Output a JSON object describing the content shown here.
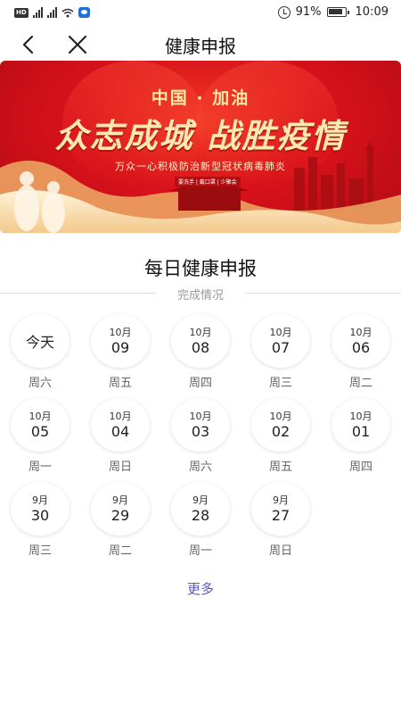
{
  "status_bar": {
    "network_tag": "HD",
    "sig1_tag": "4G",
    "sig2_tag": "4G",
    "battery": "91%",
    "time": "10:09"
  },
  "nav": {
    "title": "健康申报",
    "back_icon": "back-chevron-icon",
    "close_icon": "close-icon"
  },
  "banner": {
    "subtitle": "中国 · 加油",
    "headline": "众志成城 战胜疫情",
    "description": "万众一心积极防治新型冠状病毒肺炎",
    "footer_tag": "要洗手 | 戴口罩 | 少聚会",
    "colors": {
      "background": "#d8121b",
      "text": "#ffe9b0"
    }
  },
  "section": {
    "title": "每日健康申报",
    "divider_label": "完成情况"
  },
  "days": [
    {
      "today": "今天",
      "month": "",
      "day": "",
      "weekday": "周六"
    },
    {
      "today": "",
      "month": "10月",
      "day": "09",
      "weekday": "周五"
    },
    {
      "today": "",
      "month": "10月",
      "day": "08",
      "weekday": "周四"
    },
    {
      "today": "",
      "month": "10月",
      "day": "07",
      "weekday": "周三"
    },
    {
      "today": "",
      "month": "10月",
      "day": "06",
      "weekday": "周二"
    },
    {
      "today": "",
      "month": "10月",
      "day": "05",
      "weekday": "周一"
    },
    {
      "today": "",
      "month": "10月",
      "day": "04",
      "weekday": "周日"
    },
    {
      "today": "",
      "month": "10月",
      "day": "03",
      "weekday": "周六"
    },
    {
      "today": "",
      "month": "10月",
      "day": "02",
      "weekday": "周五"
    },
    {
      "today": "",
      "month": "10月",
      "day": "01",
      "weekday": "周四"
    },
    {
      "today": "",
      "month": "9月",
      "day": "30",
      "weekday": "周三"
    },
    {
      "today": "",
      "month": "9月",
      "day": "29",
      "weekday": "周二"
    },
    {
      "today": "",
      "month": "9月",
      "day": "28",
      "weekday": "周一"
    },
    {
      "today": "",
      "month": "9月",
      "day": "27",
      "weekday": "周日"
    }
  ],
  "more_label": "更多",
  "colors": {
    "accent_link": "#5a58c9",
    "divider": "#dcdcdc"
  }
}
